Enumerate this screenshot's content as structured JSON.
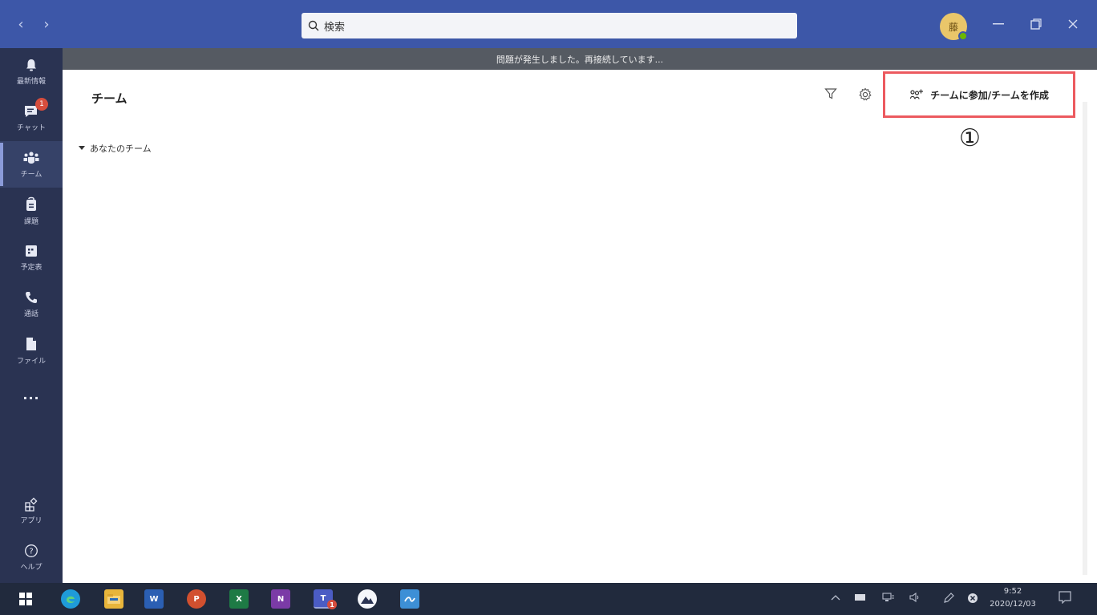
{
  "titlebar": {
    "search_placeholder": "検索",
    "avatar_initial": "藤"
  },
  "banner": {
    "text": "問題が発生しました。再接続しています..."
  },
  "rail": {
    "items": [
      {
        "label": "最新情報",
        "icon": "bell-icon"
      },
      {
        "label": "チャット",
        "icon": "chat-icon",
        "badge": "1"
      },
      {
        "label": "チーム",
        "icon": "teams-icon",
        "active": true
      },
      {
        "label": "課題",
        "icon": "assignments-icon"
      },
      {
        "label": "予定表",
        "icon": "calendar-icon"
      },
      {
        "label": "通話",
        "icon": "phone-icon"
      },
      {
        "label": "ファイル",
        "icon": "file-icon"
      },
      {
        "label": "...",
        "icon": "more-icon"
      },
      {
        "label": "アプリ",
        "icon": "apps-icon"
      },
      {
        "label": "ヘルプ",
        "icon": "help-icon"
      }
    ]
  },
  "main": {
    "title": "チーム",
    "join_create_label": "チームに参加/チームを作成",
    "annotation": "①",
    "section_label": "あなたのチーム"
  },
  "taskbar": {
    "time": "9:52",
    "date": "2020/12/03",
    "apps": [
      "start-icon",
      "edge-icon",
      "file-explorer-icon",
      "word-icon",
      "powerpoint-icon",
      "excel-icon",
      "onenote-icon",
      "teams-icon",
      "photos-icon",
      "whiteboard-icon"
    ],
    "word_letter": "W",
    "powerpoint_letter": "P",
    "excel_letter": "X",
    "onenote_letter": "N",
    "teams_letter": "T",
    "teams_badge": "1"
  },
  "colors": {
    "titlebar": "#3d57a8",
    "rail": "#2a3352",
    "banner": "#555a62",
    "highlight": "#ec5a5f",
    "taskbar": "#212a3d"
  }
}
